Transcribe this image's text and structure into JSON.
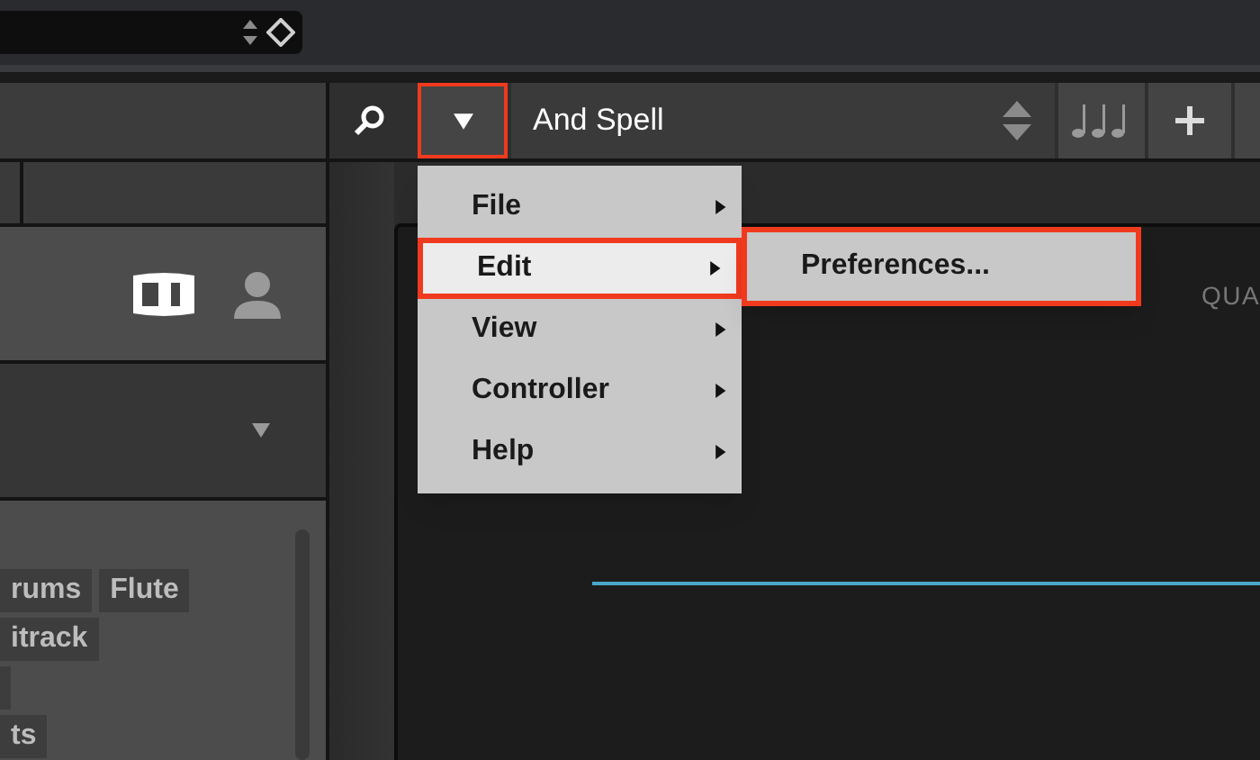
{
  "toolbar": {
    "menu_button": {
      "highlighted": true
    },
    "preset": "And Spell"
  },
  "menu": {
    "items": [
      {
        "label": "File",
        "selected": false,
        "highlighted": false
      },
      {
        "label": "Edit",
        "selected": true,
        "highlighted": true
      },
      {
        "label": "View",
        "selected": false,
        "highlighted": false
      },
      {
        "label": "Controller",
        "selected": false,
        "highlighted": false
      },
      {
        "label": "Help",
        "selected": false,
        "highlighted": false
      }
    ],
    "submenu": {
      "items": [
        "Preferences..."
      ],
      "highlighted": true
    }
  },
  "tags": [
    [
      {
        "kind": "text",
        "label": "rums"
      },
      {
        "kind": "text",
        "label": "Flute"
      }
    ],
    [
      {
        "kind": "text",
        "label": "itrack"
      }
    ],
    [
      {
        "kind": "blank"
      }
    ],
    [
      {
        "kind": "text",
        "label": "ts"
      }
    ]
  ],
  "instrument": {
    "header_text": "QUA"
  }
}
